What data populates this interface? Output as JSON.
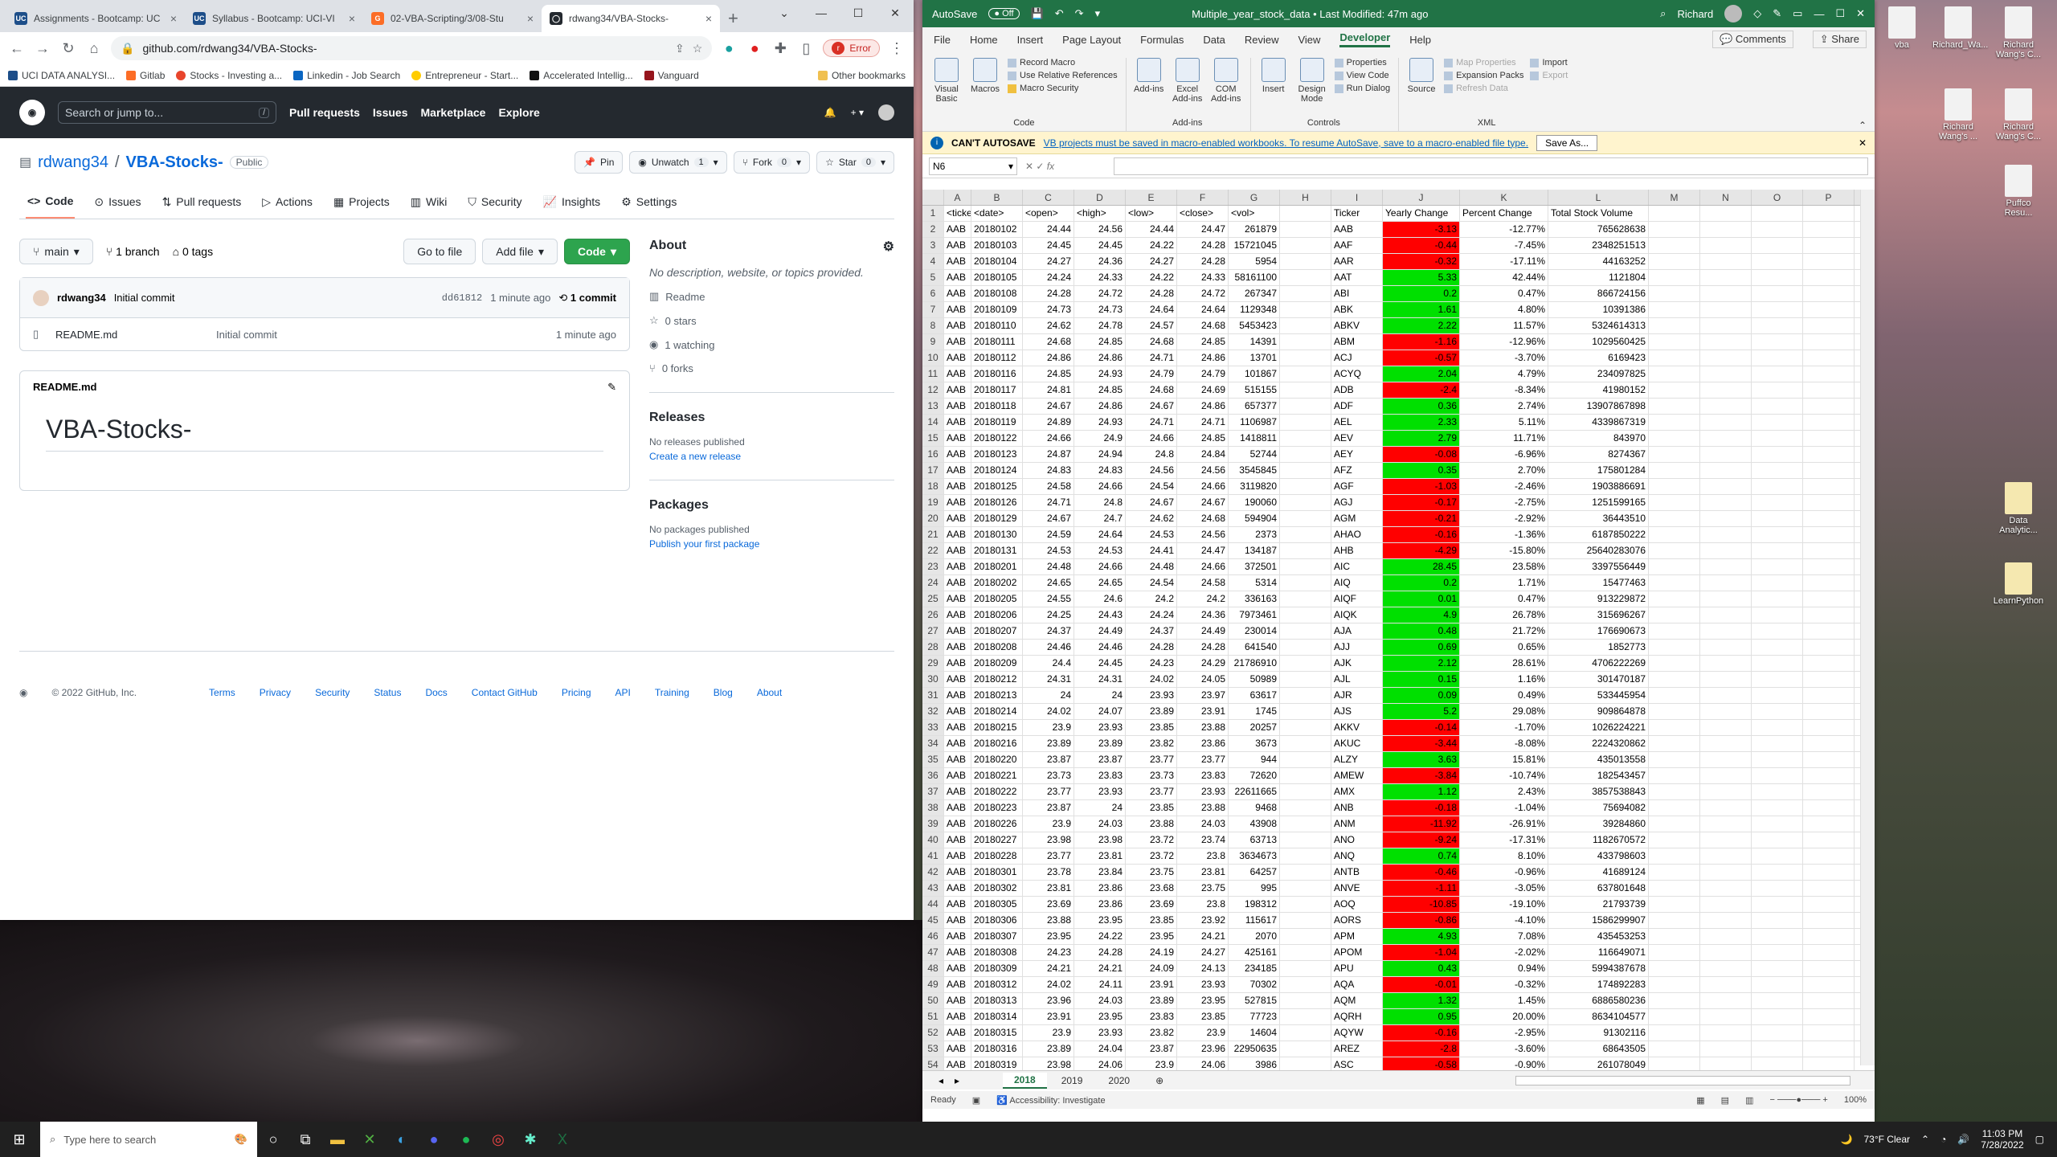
{
  "browser": {
    "tabs": [
      {
        "title": "Assignments - Bootcamp: UC",
        "color": "#1d4e89",
        "glyph": "UC"
      },
      {
        "title": "Syllabus - Bootcamp: UCI-VI",
        "color": "#1d4e89",
        "glyph": "UC"
      },
      {
        "title": "02-VBA-Scripting/3/08-Stu",
        "color": "#fc6d26",
        "glyph": "G"
      },
      {
        "title": "rdwang34/VBA-Stocks-",
        "color": "#24292f",
        "glyph": "◯"
      }
    ],
    "url": "github.com/rdwang34/VBA-Stocks-",
    "error_label": "Error",
    "profile_initial": "r",
    "bookmarks": [
      "UCI DATA ANALYSI...",
      "Gitlab",
      "Stocks - Investing a...",
      "Linkedin - Job Search",
      "Entrepreneur - Start...",
      "Accelerated Intellig...",
      "Vanguard"
    ],
    "other_bookmarks": "Other bookmarks"
  },
  "github": {
    "search_placeholder": "Search or jump to...",
    "search_key": "/",
    "nav": [
      "Pull requests",
      "Issues",
      "Marketplace",
      "Explore"
    ],
    "owner": "rdwang34",
    "repo": "VBA-Stocks-",
    "visibility": "Public",
    "pin": "Pin",
    "unwatch": "Unwatch",
    "unwatch_count": "1",
    "fork": "Fork",
    "fork_count": "0",
    "star": "Star",
    "star_count": "0",
    "tabs": [
      "Code",
      "Issues",
      "Pull requests",
      "Actions",
      "Projects",
      "Wiki",
      "Security",
      "Insights",
      "Settings"
    ],
    "branch": "main",
    "branches": "1 branch",
    "tags": "0 tags",
    "go_to_file": "Go to file",
    "add_file": "Add file",
    "code_btn": "Code",
    "commit_author": "rdwang34",
    "commit_msg": "Initial commit",
    "commit_hash": "dd61812",
    "commit_time": "1 minute ago",
    "commit_count": "1 commit",
    "file_name": "README.md",
    "file_msg": "Initial commit",
    "file_time": "1 minute ago",
    "readme_label": "README.md",
    "readme_h1": "VBA-Stocks-",
    "about": "About",
    "about_desc": "No description, website, or topics provided.",
    "about_items": [
      "Readme",
      "0 stars",
      "1 watching",
      "0 forks"
    ],
    "releases": "Releases",
    "no_releases": "No releases published",
    "create_release": "Create a new release",
    "packages": "Packages",
    "no_packages": "No packages published",
    "publish_pkg": "Publish your first package",
    "footer_copy": "© 2022 GitHub, Inc.",
    "footer_links": [
      "Terms",
      "Privacy",
      "Security",
      "Status",
      "Docs",
      "Contact GitHub",
      "Pricing",
      "API",
      "Training",
      "Blog",
      "About"
    ]
  },
  "excel": {
    "autosave": "AutoSave",
    "autosave_state": "Off",
    "doc_title": "Multiple_year_stock_data • Last Modified: 47m ago",
    "user": "Richard",
    "menu": [
      "File",
      "Home",
      "Insert",
      "Page Layout",
      "Formulas",
      "Data",
      "Review",
      "View",
      "Developer",
      "Help"
    ],
    "comments": "Comments",
    "share": "Share",
    "ribbon": {
      "code": {
        "label": "Code",
        "big": [
          "Visual Basic",
          "Macros"
        ],
        "small": [
          "Record Macro",
          "Use Relative References",
          "Macro Security"
        ]
      },
      "addins": {
        "label": "Add-ins",
        "big": [
          "Add-ins",
          "Excel Add-ins",
          "COM Add-ins"
        ]
      },
      "controls": {
        "label": "Controls",
        "big": [
          "Insert",
          "Design Mode"
        ],
        "small": [
          "Properties",
          "View Code",
          "Run Dialog"
        ]
      },
      "xml": {
        "label": "XML",
        "big": [
          "Source"
        ],
        "small": [
          "Map Properties",
          "Expansion Packs",
          "Refresh Data",
          "Import",
          "Export"
        ]
      }
    },
    "info_title": "CAN'T AUTOSAVE",
    "info_msg": "VB projects must be saved in macro-enabled workbooks. To resume AutoSave, save to a macro-enabled file type.",
    "save_as": "Save As...",
    "namebox": "N6",
    "fx": "fx",
    "columns": [
      "A",
      "B",
      "C",
      "D",
      "E",
      "F",
      "G",
      "H",
      "I",
      "J",
      "K",
      "L",
      "M",
      "N",
      "O",
      "P"
    ],
    "headers": [
      "<ticker>",
      "<date>",
      "<open>",
      "<high>",
      "<low>",
      "<close>",
      "<vol>",
      "",
      "Ticker",
      "Yearly Change",
      "Percent Change",
      "Total Stock Volume"
    ],
    "rows": [
      [
        "AAB",
        "20180102",
        "24.44",
        "24.56",
        "24.44",
        "24.47",
        "261879",
        "AAB",
        "-3.13",
        "-12.77%",
        "765628638"
      ],
      [
        "AAB",
        "20180103",
        "24.45",
        "24.45",
        "24.22",
        "24.28",
        "15721045",
        "AAF",
        "-0.44",
        "-7.45%",
        "2348251513"
      ],
      [
        "AAB",
        "20180104",
        "24.27",
        "24.36",
        "24.27",
        "24.28",
        "5954",
        "AAR",
        "-0.32",
        "-17.11%",
        "44163252"
      ],
      [
        "AAB",
        "20180105",
        "24.24",
        "24.33",
        "24.22",
        "24.33",
        "58161100",
        "AAT",
        "5.33",
        "42.44%",
        "1121804"
      ],
      [
        "AAB",
        "20180108",
        "24.28",
        "24.72",
        "24.28",
        "24.72",
        "267347",
        "ABI",
        "0.2",
        "0.47%",
        "866724156"
      ],
      [
        "AAB",
        "20180109",
        "24.73",
        "24.73",
        "24.64",
        "24.64",
        "1129348",
        "ABK",
        "1.61",
        "4.80%",
        "10391386"
      ],
      [
        "AAB",
        "20180110",
        "24.62",
        "24.78",
        "24.57",
        "24.68",
        "5453423",
        "ABKV",
        "2.22",
        "11.57%",
        "5324614313"
      ],
      [
        "AAB",
        "20180111",
        "24.68",
        "24.85",
        "24.68",
        "24.85",
        "14391",
        "ABM",
        "-1.16",
        "-12.96%",
        "1029560425"
      ],
      [
        "AAB",
        "20180112",
        "24.86",
        "24.86",
        "24.71",
        "24.86",
        "13701",
        "ACJ",
        "-0.57",
        "-3.70%",
        "6169423"
      ],
      [
        "AAB",
        "20180116",
        "24.85",
        "24.93",
        "24.79",
        "24.79",
        "101867",
        "ACYQ",
        "2.04",
        "4.79%",
        "234097825"
      ],
      [
        "AAB",
        "20180117",
        "24.81",
        "24.85",
        "24.68",
        "24.69",
        "515155",
        "ADB",
        "-2.4",
        "-8.34%",
        "41980152"
      ],
      [
        "AAB",
        "20180118",
        "24.67",
        "24.86",
        "24.67",
        "24.86",
        "657377",
        "ADF",
        "0.36",
        "2.74%",
        "13907867898"
      ],
      [
        "AAB",
        "20180119",
        "24.89",
        "24.93",
        "24.71",
        "24.71",
        "1106987",
        "AEL",
        "2.33",
        "5.11%",
        "4339867319"
      ],
      [
        "AAB",
        "20180122",
        "24.66",
        "24.9",
        "24.66",
        "24.85",
        "1418811",
        "AEV",
        "2.79",
        "11.71%",
        "843970"
      ],
      [
        "AAB",
        "20180123",
        "24.87",
        "24.94",
        "24.8",
        "24.84",
        "52744",
        "AEY",
        "-0.08",
        "-6.96%",
        "8274367"
      ],
      [
        "AAB",
        "20180124",
        "24.83",
        "24.83",
        "24.56",
        "24.56",
        "3545845",
        "AFZ",
        "0.35",
        "2.70%",
        "175801284"
      ],
      [
        "AAB",
        "20180125",
        "24.58",
        "24.66",
        "24.54",
        "24.66",
        "3119820",
        "AGF",
        "-1.03",
        "-2.46%",
        "1903886691"
      ],
      [
        "AAB",
        "20180126",
        "24.71",
        "24.8",
        "24.67",
        "24.67",
        "190060",
        "AGJ",
        "-0.17",
        "-2.75%",
        "1251599165"
      ],
      [
        "AAB",
        "20180129",
        "24.67",
        "24.7",
        "24.62",
        "24.68",
        "594904",
        "AGM",
        "-0.21",
        "-2.92%",
        "36443510"
      ],
      [
        "AAB",
        "20180130",
        "24.59",
        "24.64",
        "24.53",
        "24.56",
        "2373",
        "AHAO",
        "-0.16",
        "-1.36%",
        "6187850222"
      ],
      [
        "AAB",
        "20180131",
        "24.53",
        "24.53",
        "24.41",
        "24.47",
        "134187",
        "AHB",
        "-4.29",
        "-15.80%",
        "25640283076"
      ],
      [
        "AAB",
        "20180201",
        "24.48",
        "24.66",
        "24.48",
        "24.66",
        "372501",
        "AIC",
        "28.45",
        "23.58%",
        "3397556449"
      ],
      [
        "AAB",
        "20180202",
        "24.65",
        "24.65",
        "24.54",
        "24.58",
        "5314",
        "AIQ",
        "0.2",
        "1.71%",
        "15477463"
      ],
      [
        "AAB",
        "20180205",
        "24.55",
        "24.6",
        "24.2",
        "24.2",
        "336163",
        "AIQF",
        "0.01",
        "0.47%",
        "913229872"
      ],
      [
        "AAB",
        "20180206",
        "24.25",
        "24.43",
        "24.24",
        "24.36",
        "7973461",
        "AIQK",
        "4.9",
        "26.78%",
        "315696267"
      ],
      [
        "AAB",
        "20180207",
        "24.37",
        "24.49",
        "24.37",
        "24.49",
        "230014",
        "AJA",
        "0.48",
        "21.72%",
        "176690673"
      ],
      [
        "AAB",
        "20180208",
        "24.46",
        "24.46",
        "24.28",
        "24.28",
        "641540",
        "AJJ",
        "0.69",
        "0.65%",
        "1852773"
      ],
      [
        "AAB",
        "20180209",
        "24.4",
        "24.45",
        "24.23",
        "24.29",
        "21786910",
        "AJK",
        "2.12",
        "28.61%",
        "4706222269"
      ],
      [
        "AAB",
        "20180212",
        "24.31",
        "24.31",
        "24.02",
        "24.05",
        "50989",
        "AJL",
        "0.15",
        "1.16%",
        "301470187"
      ],
      [
        "AAB",
        "20180213",
        "24",
        "24",
        "23.93",
        "23.97",
        "63617",
        "AJR",
        "0.09",
        "0.49%",
        "533445954"
      ],
      [
        "AAB",
        "20180214",
        "24.02",
        "24.07",
        "23.89",
        "23.91",
        "1745",
        "AJS",
        "5.2",
        "29.08%",
        "909864878"
      ],
      [
        "AAB",
        "20180215",
        "23.9",
        "23.93",
        "23.85",
        "23.88",
        "20257",
        "AKKV",
        "-0.14",
        "-1.70%",
        "1026224221"
      ],
      [
        "AAB",
        "20180216",
        "23.89",
        "23.89",
        "23.82",
        "23.86",
        "3673",
        "AKUC",
        "-3.44",
        "-8.08%",
        "2224320862"
      ],
      [
        "AAB",
        "20180220",
        "23.87",
        "23.87",
        "23.77",
        "23.77",
        "944",
        "ALZY",
        "3.63",
        "15.81%",
        "435013558"
      ],
      [
        "AAB",
        "20180221",
        "23.73",
        "23.83",
        "23.73",
        "23.83",
        "72620",
        "AMEW",
        "-3.84",
        "-10.74%",
        "182543457"
      ],
      [
        "AAB",
        "20180222",
        "23.77",
        "23.93",
        "23.77",
        "23.93",
        "22611665",
        "AMX",
        "1.12",
        "2.43%",
        "3857538843"
      ],
      [
        "AAB",
        "20180223",
        "23.87",
        "24",
        "23.85",
        "23.88",
        "9468",
        "ANB",
        "-0.18",
        "-1.04%",
        "75694082"
      ],
      [
        "AAB",
        "20180226",
        "23.9",
        "24.03",
        "23.88",
        "24.03",
        "43908",
        "ANM",
        "-11.92",
        "-26.91%",
        "39284860"
      ],
      [
        "AAB",
        "20180227",
        "23.98",
        "23.98",
        "23.72",
        "23.74",
        "63713",
        "ANO",
        "-9.24",
        "-17.31%",
        "1182670572"
      ],
      [
        "AAB",
        "20180228",
        "23.77",
        "23.81",
        "23.72",
        "23.8",
        "3634673",
        "ANQ",
        "0.74",
        "8.10%",
        "433798603"
      ],
      [
        "AAB",
        "20180301",
        "23.78",
        "23.84",
        "23.75",
        "23.81",
        "64257",
        "ANTB",
        "-0.46",
        "-0.96%",
        "41689124"
      ],
      [
        "AAB",
        "20180302",
        "23.81",
        "23.86",
        "23.68",
        "23.75",
        "995",
        "ANVE",
        "-1.11",
        "-3.05%",
        "637801648"
      ],
      [
        "AAB",
        "20180305",
        "23.69",
        "23.86",
        "23.69",
        "23.8",
        "198312",
        "AOQ",
        "-10.85",
        "-19.10%",
        "21793739"
      ],
      [
        "AAB",
        "20180306",
        "23.88",
        "23.95",
        "23.85",
        "23.92",
        "115617",
        "AORS",
        "-0.86",
        "-4.10%",
        "1586299907"
      ],
      [
        "AAB",
        "20180307",
        "23.95",
        "24.22",
        "23.95",
        "24.21",
        "2070",
        "APM",
        "4.93",
        "7.08%",
        "435453253"
      ],
      [
        "AAB",
        "20180308",
        "24.23",
        "24.28",
        "24.19",
        "24.27",
        "425161",
        "APOM",
        "-1.04",
        "-2.02%",
        "116649071"
      ],
      [
        "AAB",
        "20180309",
        "24.21",
        "24.21",
        "24.09",
        "24.13",
        "234185",
        "APU",
        "0.43",
        "0.94%",
        "5994387678"
      ],
      [
        "AAB",
        "20180312",
        "24.02",
        "24.11",
        "23.91",
        "23.93",
        "70302",
        "AQA",
        "-0.01",
        "-0.32%",
        "174892283"
      ],
      [
        "AAB",
        "20180313",
        "23.96",
        "24.03",
        "23.89",
        "23.95",
        "527815",
        "AQM",
        "1.32",
        "1.45%",
        "6886580236"
      ],
      [
        "AAB",
        "20180314",
        "23.91",
        "23.95",
        "23.83",
        "23.85",
        "77723",
        "AQRH",
        "0.95",
        "20.00%",
        "8634104577"
      ],
      [
        "AAB",
        "20180315",
        "23.9",
        "23.93",
        "23.82",
        "23.9",
        "14604",
        "AQYW",
        "-0.16",
        "-2.95%",
        "91302116"
      ],
      [
        "AAB",
        "20180316",
        "23.89",
        "24.04",
        "23.87",
        "23.96",
        "22950635",
        "AREZ",
        "-2.8",
        "-3.60%",
        "68643505"
      ],
      [
        "AAB",
        "20180319",
        "23.98",
        "24.06",
        "23.9",
        "24.06",
        "3986",
        "ASC",
        "-0.58",
        "-0.90%",
        "261078049"
      ]
    ],
    "sheets": [
      "2018",
      "2019",
      "2020"
    ],
    "status_ready": "Ready",
    "status_access": "Accessibility: Investigate",
    "zoom": "100%"
  },
  "desktop": {
    "icons_right": [
      "vba",
      "Richard_Wa...",
      "Richard Wang's C...",
      "Richard Wang's ...",
      "Richard Wang's C...",
      "Puffco Resu...",
      "Data Analytic...",
      "LearnPython"
    ]
  },
  "taskbar": {
    "search": "Type here to search",
    "weather": "73°F  Clear",
    "time": "11:03 PM",
    "date": "7/28/2022"
  }
}
